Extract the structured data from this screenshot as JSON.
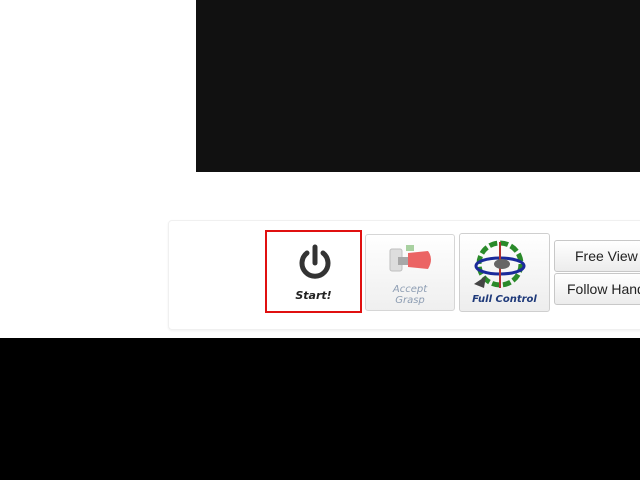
{
  "toolbar": {
    "start_label": "Start!",
    "accept_grasp_label_line1": "Accept",
    "accept_grasp_label_line2": "Grasp",
    "full_control_label": "Full Control",
    "free_view_label": "Free View",
    "follow_hand_label": "Follow Hand"
  },
  "colors": {
    "start_highlight": "#e01010",
    "full_control_text": "#1f3a7a",
    "accept_grasp_text": "#7a8da6",
    "viewport_bg": "#111111"
  },
  "icons": {
    "start": "power-icon",
    "accept_grasp": "robot-gripper-icon",
    "full_control": "rotation-gizmo-icon"
  }
}
